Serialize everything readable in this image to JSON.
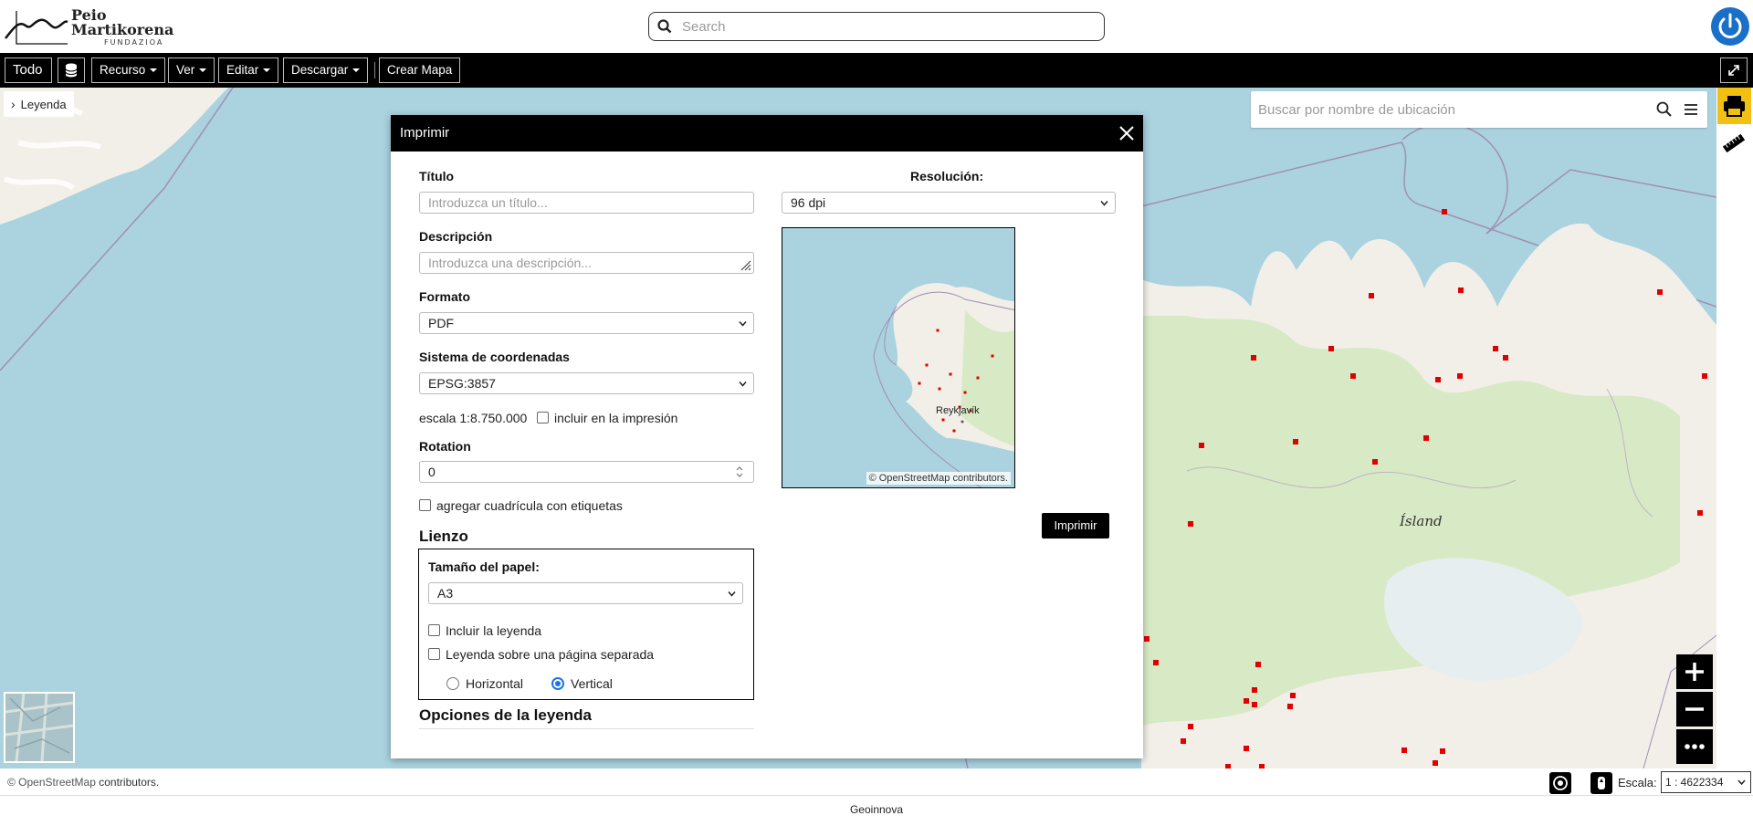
{
  "header": {
    "logo_line1": "Peio",
    "logo_line2": "Martikorena",
    "logo_line3": "FUNDAZIOA",
    "search_placeholder": "Search"
  },
  "toolbar": {
    "all_label": "Todo",
    "resource_label": "Recurso",
    "view_label": "Ver",
    "edit_label": "Editar",
    "download_label": "Descargar",
    "create_map_label": "Crear Mapa"
  },
  "map": {
    "legend_toggle": "Leyenda",
    "location_search_placeholder": "Buscar por nombre de ubicación",
    "country_label": "Ísland",
    "zoom_in": "+",
    "zoom_out": "−",
    "more": "•••"
  },
  "status": {
    "attribution_osm": "© OpenStreetMap",
    "attribution_rest": " contributors.",
    "scale_label": "Escala:",
    "scale_value": "1 : 4622334",
    "footer": "Geoinnova"
  },
  "print_dialog": {
    "title": "Imprimir",
    "title_label": "Título",
    "title_placeholder": "Introduzca un título...",
    "description_label": "Descripción",
    "description_placeholder": "Introduzca una descripción...",
    "format_label": "Formato",
    "format_value": "PDF",
    "crs_label": "Sistema de coordenadas",
    "crs_value": "EPSG:3857",
    "scale_text": "escala 1:8.750.000",
    "include_scale_label": "incluir en la impresión",
    "rotation_label": "Rotation",
    "rotation_value": "0",
    "grid_label": "agregar cuadrícula con etiquetas",
    "canvas_heading": "Lienzo",
    "paper_size_label": "Tamaño del papel:",
    "paper_size_value": "A3",
    "include_legend_label": "Incluir la leyenda",
    "legend_separate_label": "Leyenda sobre una página separada",
    "orientation_horizontal": "Horizontal",
    "orientation_vertical": "Vertical",
    "orientation_selected": "Vertical",
    "legend_options_heading": "Opciones de la leyenda",
    "resolution_label": "Resolución:",
    "resolution_value": "96 dpi",
    "preview_city": "Reykjavík",
    "preview_attr_osm": "© OpenStreetMap",
    "preview_attr_rest": " contributors.",
    "print_button": "Imprimir"
  },
  "colors": {
    "sea": "#aad3df",
    "land": "#f2efe9",
    "land_green": "#cde8b5",
    "marker": "#e00000",
    "accent_yellow": "#f2c012",
    "power_blue": "#1a6fc9",
    "radio_blue": "#1a73e8"
  }
}
